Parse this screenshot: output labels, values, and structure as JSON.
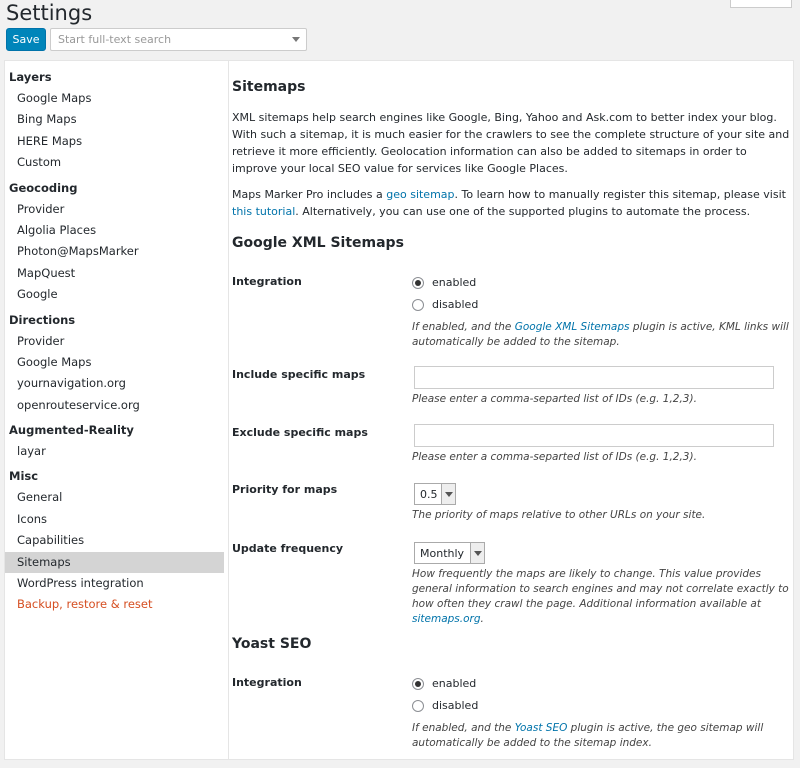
{
  "header": {
    "title": "Settings",
    "save_label": "Save",
    "search_placeholder": "Start full-text search"
  },
  "sidebar": {
    "groups": [
      {
        "label": "Layers",
        "items": [
          "Google Maps",
          "Bing Maps",
          "HERE Maps",
          "Custom"
        ]
      },
      {
        "label": "Geocoding",
        "items": [
          "Provider",
          "Algolia Places",
          "Photon@MapsMarker",
          "MapQuest",
          "Google"
        ]
      },
      {
        "label": "Directions",
        "items": [
          "Provider",
          "Google Maps",
          "yournavigation.org",
          "openrouteservice.org"
        ]
      },
      {
        "label": "Augmented-Reality",
        "items": [
          "layar"
        ]
      },
      {
        "label": "Misc",
        "items": [
          "General",
          "Icons",
          "Capabilities",
          "Sitemaps",
          "WordPress integration",
          "Backup, restore & reset"
        ]
      }
    ],
    "active_item": "Sitemaps"
  },
  "content": {
    "heading": "Sitemaps",
    "intro": "XML sitemaps help search engines like Google, Bing, Yahoo and Ask.com to better index your blog. With such a sitemap, it is much easier for the crawlers to see the complete structure of your site and retrieve it more efficiently. Geolocation information can also be added to sitemaps in order to improve your local SEO value for services like Google Places.",
    "geo_p": {
      "before": "Maps Marker Pro includes a ",
      "link1": "geo sitemap",
      "middle": ". To learn how to manually register this sitemap, please visit ",
      "link2": "this tutorial",
      "after": ". Alternatively, you can use one of the supported plugins to automate the process."
    },
    "google": {
      "heading": "Google XML Sitemaps",
      "integration_label": "Integration",
      "enabled_label": "enabled",
      "disabled_label": "disabled",
      "integration_value": "enabled",
      "integration_desc_before": "If enabled, and the ",
      "integration_desc_link": "Google XML Sitemaps",
      "integration_desc_after": " plugin is active, KML links will automatically be added to the sitemap.",
      "include_label": "Include specific maps",
      "include_value": "",
      "include_desc": "Please enter a comma-separted list of IDs (e.g. 1,2,3).",
      "exclude_label": "Exclude specific maps",
      "exclude_value": "",
      "exclude_desc": "Please enter a comma-separted list of IDs (e.g. 1,2,3).",
      "priority_label": "Priority for maps",
      "priority_value": "0.5",
      "priority_desc": "The priority of maps relative to other URLs on your site.",
      "frequency_label": "Update frequency",
      "frequency_value": "Monthly",
      "frequency_desc_before": "How frequently the maps are likely to change. This value provides general information to search engines and may not correlate exactly to how often they crawl the page. Additional information available at ",
      "frequency_desc_link": "sitemaps.org",
      "frequency_desc_after": "."
    },
    "yoast": {
      "heading": "Yoast SEO",
      "integration_label": "Integration",
      "enabled_label": "enabled",
      "disabled_label": "disabled",
      "integration_value": "enabled",
      "desc_before": "If enabled, and the ",
      "desc_link": "Yoast SEO",
      "desc_after": " plugin is active, the geo sitemap will automatically be added to the sitemap index."
    }
  },
  "colors": {
    "primary_button": "#0085ba",
    "link": "#0073aa",
    "danger": "#d54e21",
    "active_bg": "#d4d4d4"
  }
}
